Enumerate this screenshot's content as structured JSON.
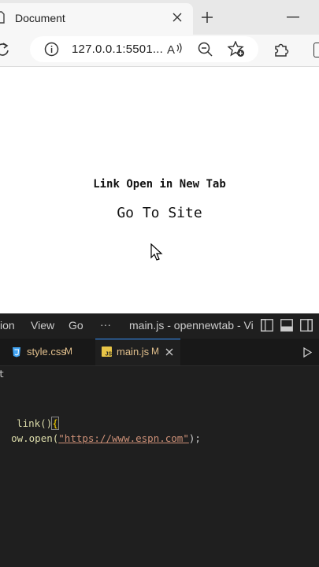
{
  "browser": {
    "tab_title": "Document",
    "url": "127.0.0.1:5501...",
    "new_tab_symbol": "+",
    "close_symbol": "✕",
    "minimize_symbol": "—"
  },
  "page": {
    "heading": "Link Open in New Tab",
    "link_text": "Go To Site"
  },
  "editor": {
    "menu": [
      "ion",
      "View",
      "Go",
      "···"
    ],
    "window_title": "main.js - opennewtab - Vi",
    "tabs": [
      {
        "icon": "css-file-icon",
        "label": "style.css",
        "badge": "M"
      },
      {
        "icon": "js-file-icon",
        "label": "main.js",
        "badge": "M",
        "active": true
      }
    ],
    "code": {
      "line_1_partial": "t",
      "line_2_function": "link()",
      "line_2_brace": "{",
      "line_3_call": "ow.open(",
      "line_3_string": "\"https://www.espn.com\"",
      "line_3_end": ");"
    },
    "colors": {
      "background": "#1f1f1f",
      "function": "#dcdcaa",
      "string": "#ce9178",
      "modified": "#e2c08d"
    }
  }
}
